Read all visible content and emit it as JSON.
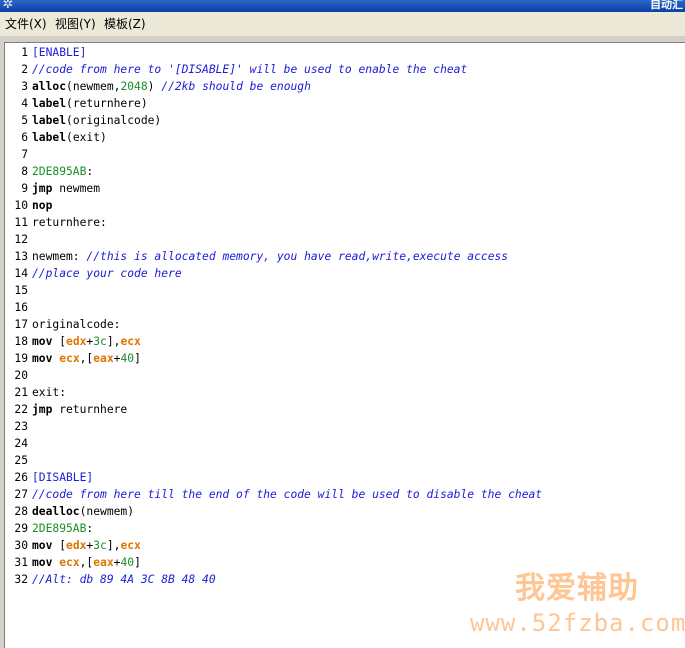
{
  "window": {
    "title": "自动汇",
    "app_icon": "gear-icon"
  },
  "menu": [
    {
      "label": "文件(X)"
    },
    {
      "label": "视图(Y)"
    },
    {
      "label": "模板(Z)"
    }
  ],
  "colors": {
    "comment": "#1b1bd8",
    "number": "#1a8c2a",
    "register": "#e07400",
    "keyword": "#000000"
  },
  "code_lines": [
    {
      "n": "1",
      "tokens": [
        {
          "t": "[ENABLE]",
          "c": "blue"
        }
      ]
    },
    {
      "n": "2",
      "tokens": [
        {
          "t": "//code from here to '[DISABLE]' will be used to enable the cheat",
          "c": "cmt"
        }
      ]
    },
    {
      "n": "3",
      "tokens": [
        {
          "t": "alloc",
          "c": "kw"
        },
        {
          "t": "(newmem,",
          "c": ""
        },
        {
          "t": "2048",
          "c": "num"
        },
        {
          "t": ") ",
          "c": ""
        },
        {
          "t": "//2kb should be enough",
          "c": "cmt"
        }
      ]
    },
    {
      "n": "4",
      "tokens": [
        {
          "t": "label",
          "c": "kw"
        },
        {
          "t": "(returnhere)",
          "c": ""
        }
      ]
    },
    {
      "n": "5",
      "tokens": [
        {
          "t": "label",
          "c": "kw"
        },
        {
          "t": "(originalcode)",
          "c": ""
        }
      ]
    },
    {
      "n": "6",
      "tokens": [
        {
          "t": "label",
          "c": "kw"
        },
        {
          "t": "(exit)",
          "c": ""
        }
      ]
    },
    {
      "n": "7",
      "tokens": []
    },
    {
      "n": "8",
      "tokens": [
        {
          "t": "2DE895AB",
          "c": "num"
        },
        {
          "t": ":",
          "c": ""
        }
      ]
    },
    {
      "n": "9",
      "tokens": [
        {
          "t": "jmp",
          "c": "kw"
        },
        {
          "t": " newmem",
          "c": ""
        }
      ]
    },
    {
      "n": "10",
      "tokens": [
        {
          "t": "nop",
          "c": "kw"
        }
      ]
    },
    {
      "n": "11",
      "tokens": [
        {
          "t": "returnhere:",
          "c": ""
        }
      ]
    },
    {
      "n": "12",
      "tokens": []
    },
    {
      "n": "13",
      "tokens": [
        {
          "t": "newmem: ",
          "c": ""
        },
        {
          "t": "//this is allocated memory, you have read,write,execute access",
          "c": "cmt"
        }
      ]
    },
    {
      "n": "14",
      "tokens": [
        {
          "t": "//place your code here",
          "c": "cmt"
        }
      ]
    },
    {
      "n": "15",
      "tokens": []
    },
    {
      "n": "16",
      "tokens": []
    },
    {
      "n": "17",
      "tokens": [
        {
          "t": "originalcode:",
          "c": ""
        }
      ]
    },
    {
      "n": "18",
      "tokens": [
        {
          "t": "mov",
          "c": "kw"
        },
        {
          "t": " [",
          "c": ""
        },
        {
          "t": "edx",
          "c": "reg"
        },
        {
          "t": "+",
          "c": ""
        },
        {
          "t": "3c",
          "c": "num"
        },
        {
          "t": "],",
          "c": ""
        },
        {
          "t": "ecx",
          "c": "reg"
        }
      ]
    },
    {
      "n": "19",
      "tokens": [
        {
          "t": "mov",
          "c": "kw"
        },
        {
          "t": " ",
          "c": ""
        },
        {
          "t": "ecx",
          "c": "reg"
        },
        {
          "t": ",[",
          "c": ""
        },
        {
          "t": "eax",
          "c": "reg"
        },
        {
          "t": "+",
          "c": ""
        },
        {
          "t": "40",
          "c": "num"
        },
        {
          "t": "]",
          "c": ""
        }
      ]
    },
    {
      "n": "20",
      "tokens": []
    },
    {
      "n": "21",
      "tokens": [
        {
          "t": "exit:",
          "c": ""
        }
      ]
    },
    {
      "n": "22",
      "tokens": [
        {
          "t": "jmp",
          "c": "kw"
        },
        {
          "t": " returnhere",
          "c": ""
        }
      ]
    },
    {
      "n": "23",
      "tokens": []
    },
    {
      "n": "24",
      "tokens": []
    },
    {
      "n": "25",
      "tokens": []
    },
    {
      "n": "26",
      "tokens": [
        {
          "t": "[DISABLE]",
          "c": "blue"
        }
      ]
    },
    {
      "n": "27",
      "tokens": [
        {
          "t": "//code from here till the end of the code will be used to disable the cheat",
          "c": "cmt"
        }
      ]
    },
    {
      "n": "28",
      "tokens": [
        {
          "t": "dealloc",
          "c": "kw"
        },
        {
          "t": "(newmem)",
          "c": ""
        }
      ]
    },
    {
      "n": "29",
      "tokens": [
        {
          "t": "2DE895AB",
          "c": "num"
        },
        {
          "t": ":",
          "c": ""
        }
      ]
    },
    {
      "n": "30",
      "tokens": [
        {
          "t": "mov",
          "c": "kw"
        },
        {
          "t": " [",
          "c": ""
        },
        {
          "t": "edx",
          "c": "reg"
        },
        {
          "t": "+",
          "c": ""
        },
        {
          "t": "3c",
          "c": "num"
        },
        {
          "t": "],",
          "c": ""
        },
        {
          "t": "ecx",
          "c": "reg"
        }
      ]
    },
    {
      "n": "31",
      "tokens": [
        {
          "t": "mov",
          "c": "kw"
        },
        {
          "t": " ",
          "c": ""
        },
        {
          "t": "ecx",
          "c": "reg"
        },
        {
          "t": ",[",
          "c": ""
        },
        {
          "t": "eax",
          "c": "reg"
        },
        {
          "t": "+",
          "c": ""
        },
        {
          "t": "40",
          "c": "num"
        },
        {
          "t": "]",
          "c": ""
        }
      ]
    },
    {
      "n": "32",
      "tokens": [
        {
          "t": "//Alt: db 89 4A 3C 8B 48 40",
          "c": "cmt"
        }
      ]
    }
  ],
  "watermark": {
    "text_cn": "我爱辅助",
    "url": "www.52fzba.com"
  }
}
